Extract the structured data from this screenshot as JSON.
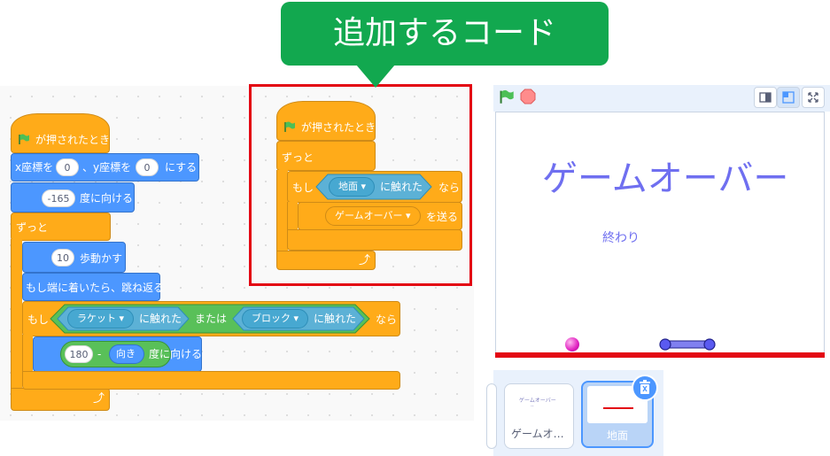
{
  "callout": {
    "text": "追加するコード"
  },
  "script1": {
    "hat_label": "が押されたとき",
    "goto": {
      "prefix": "x座標を",
      "x": "0",
      "mid": "、y座標を",
      "y": "0",
      "suffix": "にする"
    },
    "point": {
      "value": "-165",
      "suffix": "度に向ける"
    },
    "forever": "ずっと",
    "move": {
      "value": "10",
      "suffix": "歩動かす"
    },
    "bounce": "もし端に着いたら、跳ね返る",
    "if": {
      "prefix": "もし",
      "touch1": "ラケット",
      "touched1": "に触れた",
      "or": "または",
      "touch2": "ブロック",
      "touched2": "に触れた",
      "then": "なら"
    },
    "turn": {
      "value": "180",
      "minus": "-",
      "dir": "向き",
      "suffix": "度に向ける"
    }
  },
  "script2": {
    "hat_label": "が押されたとき",
    "forever": "ずっと",
    "if_prefix": "もし",
    "touch": "地面",
    "touched": "に触れた",
    "then": "なら",
    "broadcast_msg": "ゲームオーバー",
    "broadcast_suffix": "を送る"
  },
  "stage": {
    "title_text": "ゲームオーバー",
    "sub_text": "終わり"
  },
  "sprites": [
    {
      "name": "",
      "selected": false
    },
    {
      "name": "ゲームオ…",
      "thumb_text": "ゲームオーバー",
      "selected": false
    },
    {
      "name": "地面",
      "selected": true
    }
  ],
  "colors": {
    "events": "#ffab19",
    "motion": "#4c97ff",
    "sensing": "#5cb1d6",
    "operators": "#59c059",
    "highlight": "#e30613",
    "callout": "#12a84f",
    "stage_text": "#6f6ff0"
  }
}
